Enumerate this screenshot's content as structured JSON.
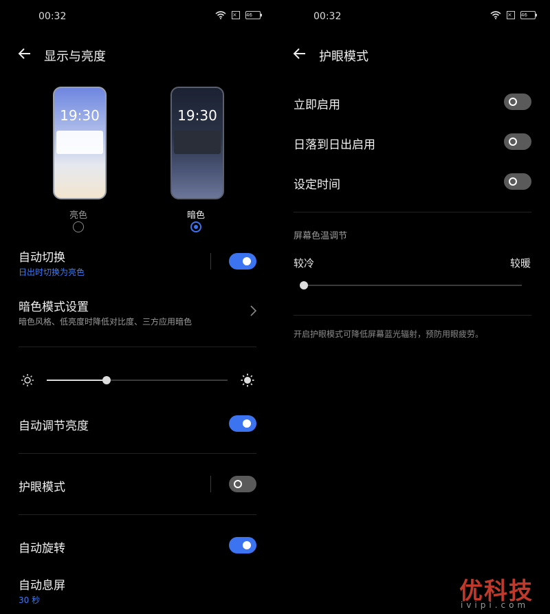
{
  "left": {
    "status": {
      "time": "00:32",
      "battery": "46"
    },
    "title": "显示与亮度",
    "preview_time": "19:30",
    "modes": {
      "light_label": "亮色",
      "dark_label": "暗色",
      "selected": "dark"
    },
    "auto_switch": {
      "label": "自动切换",
      "sub": "日出时切换为亮色",
      "on": true
    },
    "dark_settings": {
      "label": "暗色模式设置",
      "sub": "暗色风格、低亮度时降低对比度、三方应用暗色"
    },
    "brightness": {
      "level": 0.33
    },
    "auto_brightness": {
      "label": "自动调节亮度",
      "on": true
    },
    "eye_comfort": {
      "label": "护眼模式",
      "on": false
    },
    "auto_rotate": {
      "label": "自动旋转",
      "on": true
    },
    "screen_timeout": {
      "label": "自动息屏",
      "value": "30 秒"
    }
  },
  "right": {
    "status": {
      "time": "00:32",
      "battery": "46"
    },
    "title": "护眼模式",
    "items": [
      {
        "label": "立即启用",
        "on": false
      },
      {
        "label": "日落到日出启用",
        "on": false
      },
      {
        "label": "设定时间",
        "on": false
      }
    ],
    "temp_section": "屏幕色温调节",
    "cool_label": "较冷",
    "warm_label": "较暖",
    "temp_level": 0.0,
    "footer": "开启护眼模式可降低屏幕蓝光辐射，预防用眼疲劳。"
  },
  "watermark": {
    "main": "优科技",
    "sub": "ivipi.com"
  },
  "colors": {
    "accent": "#3b73f0",
    "background": "#000000",
    "watermark": "#c0392b"
  },
  "icons": [
    "back-arrow-icon",
    "wifi-icon",
    "sim-icon",
    "battery-icon",
    "chevron-right-icon",
    "sun-small-icon",
    "sun-large-icon"
  ]
}
